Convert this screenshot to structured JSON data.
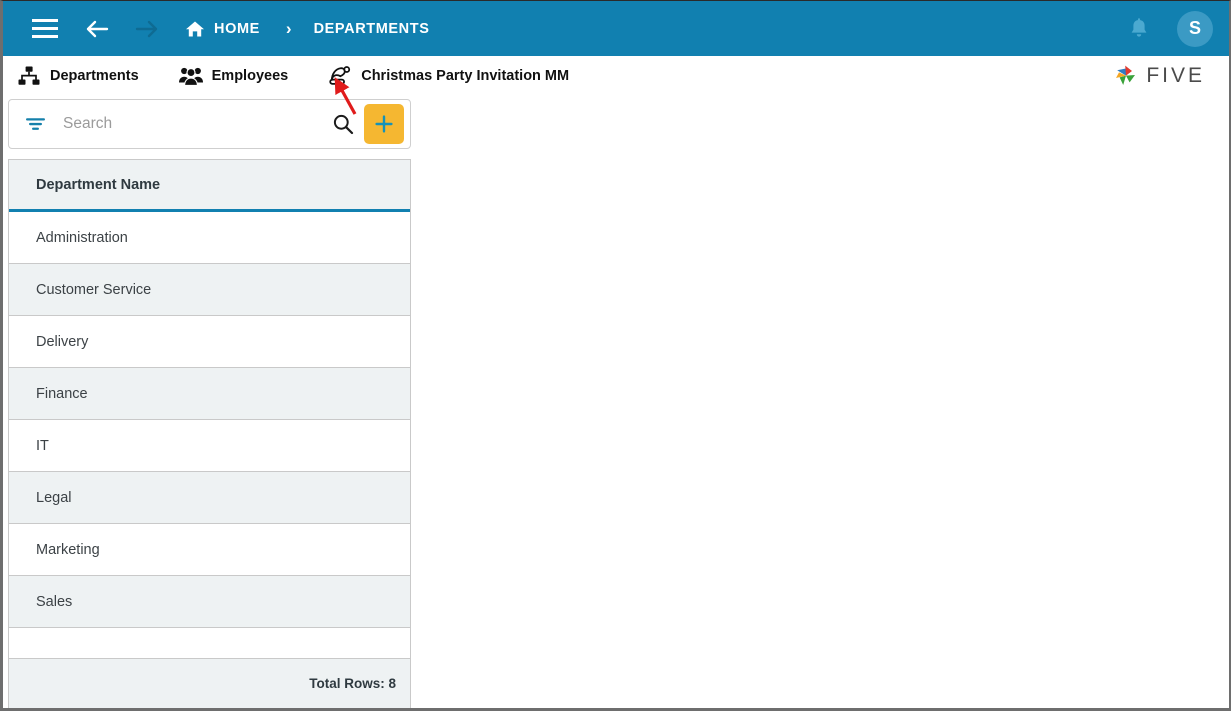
{
  "window": {
    "title": "Departments"
  },
  "topbar": {
    "menu_icon": "hamburger-menu-icon",
    "back_icon": "arrow-left-icon",
    "forward_icon": "arrow-right-icon",
    "home_icon": "home-icon",
    "home_label": "HOME",
    "separator": "›",
    "current_label": "DEPARTMENTS",
    "notification_icon": "bell-icon",
    "avatar_initial": "S",
    "background_color": "#1180b0"
  },
  "tabs": [
    {
      "label": "Departments",
      "icon": "sitemap-icon",
      "active": true
    },
    {
      "label": "Employees",
      "icon": "users-group-icon",
      "active": false
    },
    {
      "label": "Christmas Party Invitation MM",
      "icon": "santa-hat-icon",
      "active": false
    }
  ],
  "brand": {
    "name": "FIVE",
    "logo_icon": "five-pinwheel-logo",
    "colors": [
      "#2e7cc4",
      "#e03a2f",
      "#f5a623",
      "#3aa23a"
    ]
  },
  "search": {
    "filter_icon": "filter-icon",
    "placeholder": "Search",
    "value": "",
    "search_icon": "magnifier-icon",
    "add_icon": "plus-icon",
    "add_button_color": "#f5b731",
    "add_icon_color": "#1592b8"
  },
  "grid": {
    "columns": [
      "Department Name"
    ],
    "rows": [
      "Administration",
      "Customer Service",
      "Delivery",
      "Finance",
      "IT",
      "Legal",
      "Marketing",
      "Sales"
    ],
    "footer_label": "Total Rows: 8",
    "header_accent_color": "#1180b0",
    "stripe_color": "#eef2f3"
  },
  "annotation": {
    "arrow_color": "#e01b1b",
    "points_to": "santa-hat-icon"
  }
}
